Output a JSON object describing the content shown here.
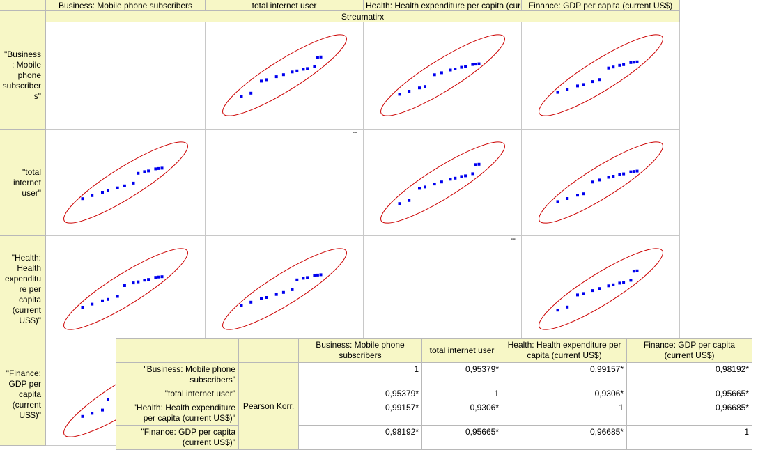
{
  "matrix": {
    "title": "Streumatirx",
    "columns": [
      "Business: Mobile phone subscribers",
      "total internet user",
      "Health: Health expenditure per capita (current US$)",
      "Finance: GDP per capita (current US$)"
    ],
    "rows": [
      "\"Business: Mobile phone subscribers\"",
      "\"total internet user\"",
      "\"Health: Health expenditure per capita (current US$)\"",
      "\"Finance: GDP per capita (current US$)\""
    ],
    "diagonal_mark": "--"
  },
  "colors": {
    "header_bg": "#f7f7c6",
    "points": "#0000ee",
    "ellipse": "#cc0000"
  },
  "chart_data": {
    "type": "scatter",
    "title": "Streumatirx",
    "variables": [
      "Business: Mobile phone subscribers",
      "total internet user",
      "Health: Health expenditure per capita (current US$)",
      "Finance: GDP per capita (current US$)"
    ],
    "series": [
      {
        "values": [
          0.0,
          0.12,
          0.25,
          0.32,
          0.44,
          0.53,
          0.64,
          0.7,
          0.78,
          0.83,
          0.92,
          0.96,
          1.0
        ]
      }
    ]
  },
  "table": {
    "headers": [
      "Business: Mobile phone subscribers",
      "total internet user",
      "Health: Health expenditure per capita (current US$)",
      "Finance: GDP per capita (current US$)"
    ],
    "stat_label": "Pearson Korr.",
    "rows": [
      {
        "label": "\"Business: Mobile phone subscribers\"",
        "values": [
          "1",
          "0,95379*",
          "0,99157*",
          "0,98192*"
        ]
      },
      {
        "label": "\"total internet user\"",
        "values": [
          "0,95379*",
          "1",
          "0,9306*",
          "0,95665*"
        ]
      },
      {
        "label": "\"Health: Health expenditure per capita (current US$)\"",
        "values": [
          "0,99157*",
          "0,9306*",
          "1",
          "0,96685*"
        ]
      },
      {
        "label": "\"Finance: GDP per capita (current US$)\"",
        "values": [
          "0,98192*",
          "0,95665*",
          "0,96685*",
          "1"
        ]
      }
    ]
  }
}
